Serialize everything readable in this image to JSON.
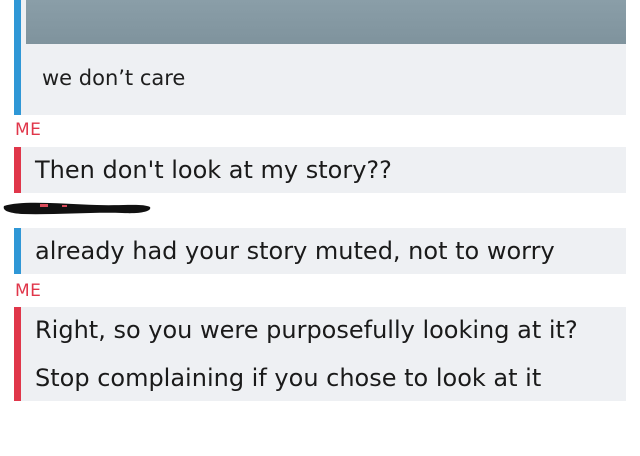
{
  "chat": {
    "media_caption": "we don’t care",
    "messages": [
      {
        "sender": "ME",
        "lines": [
          "Then don't look at my story??"
        ]
      },
      {
        "sender": "",
        "lines": [
          "already had your story muted, not to worry"
        ]
      },
      {
        "sender": "ME",
        "lines": [
          "Right, so you were purposefully looking at it?",
          "Stop complaining if you chose to look at it"
        ]
      }
    ]
  },
  "colors": {
    "me_accent": "#e0364a",
    "friend_accent": "#2f97d6",
    "bubble_bg": "#eef0f3"
  }
}
